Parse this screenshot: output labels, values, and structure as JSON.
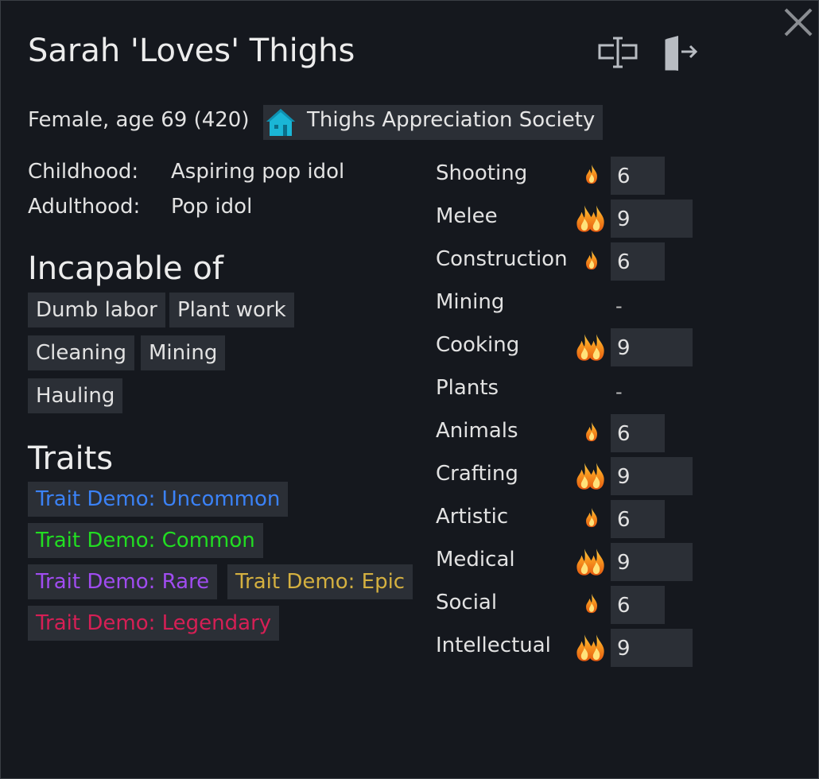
{
  "window": {
    "title": "Sarah 'Loves' Thighs",
    "description": "Female, age 69 (420)",
    "faction": "Thighs Appreciation Society"
  },
  "backstory": {
    "childhood_label": "Childhood:",
    "childhood_value": "Aspiring pop idol",
    "adulthood_label": "Adulthood:",
    "adulthood_value": "Pop idol"
  },
  "incapable": {
    "heading": "Incapable of",
    "items": [
      "Dumb labor",
      "Plant work",
      "Cleaning",
      "Mining",
      "Hauling"
    ]
  },
  "traits": {
    "heading": "Traits",
    "items": [
      {
        "label": "Trait Demo: Uncommon",
        "color": "#3b82f6"
      },
      {
        "label": "Trait Demo: Common",
        "color": "#22dd22"
      },
      {
        "label": "Trait Demo: Rare",
        "color": "#a04cf0"
      },
      {
        "label": "Trait Demo: Epic",
        "color": "#d4b040"
      },
      {
        "label": "Trait Demo: Legendary",
        "color": "#d61f55"
      }
    ]
  },
  "skills": [
    {
      "name": "Shooting",
      "level": "6",
      "passion": "minor"
    },
    {
      "name": "Melee",
      "level": "9",
      "passion": "major"
    },
    {
      "name": "Construction",
      "level": "6",
      "passion": "minor"
    },
    {
      "name": "Mining",
      "level": "-",
      "passion": "none"
    },
    {
      "name": "Cooking",
      "level": "9",
      "passion": "major"
    },
    {
      "name": "Plants",
      "level": "-",
      "passion": "none"
    },
    {
      "name": "Animals",
      "level": "6",
      "passion": "minor"
    },
    {
      "name": "Crafting",
      "level": "9",
      "passion": "major"
    },
    {
      "name": "Artistic",
      "level": "6",
      "passion": "minor"
    },
    {
      "name": "Medical",
      "level": "9",
      "passion": "major"
    },
    {
      "name": "Social",
      "level": "6",
      "passion": "minor"
    },
    {
      "name": "Intellectual",
      "level": "9",
      "passion": "major"
    }
  ],
  "icons": {
    "close": "close-icon",
    "rename": "rename-icon",
    "banish": "banish-icon",
    "faction": "house-icon",
    "passion_minor": "flame-icon",
    "passion_major": "double-flame-icon"
  }
}
